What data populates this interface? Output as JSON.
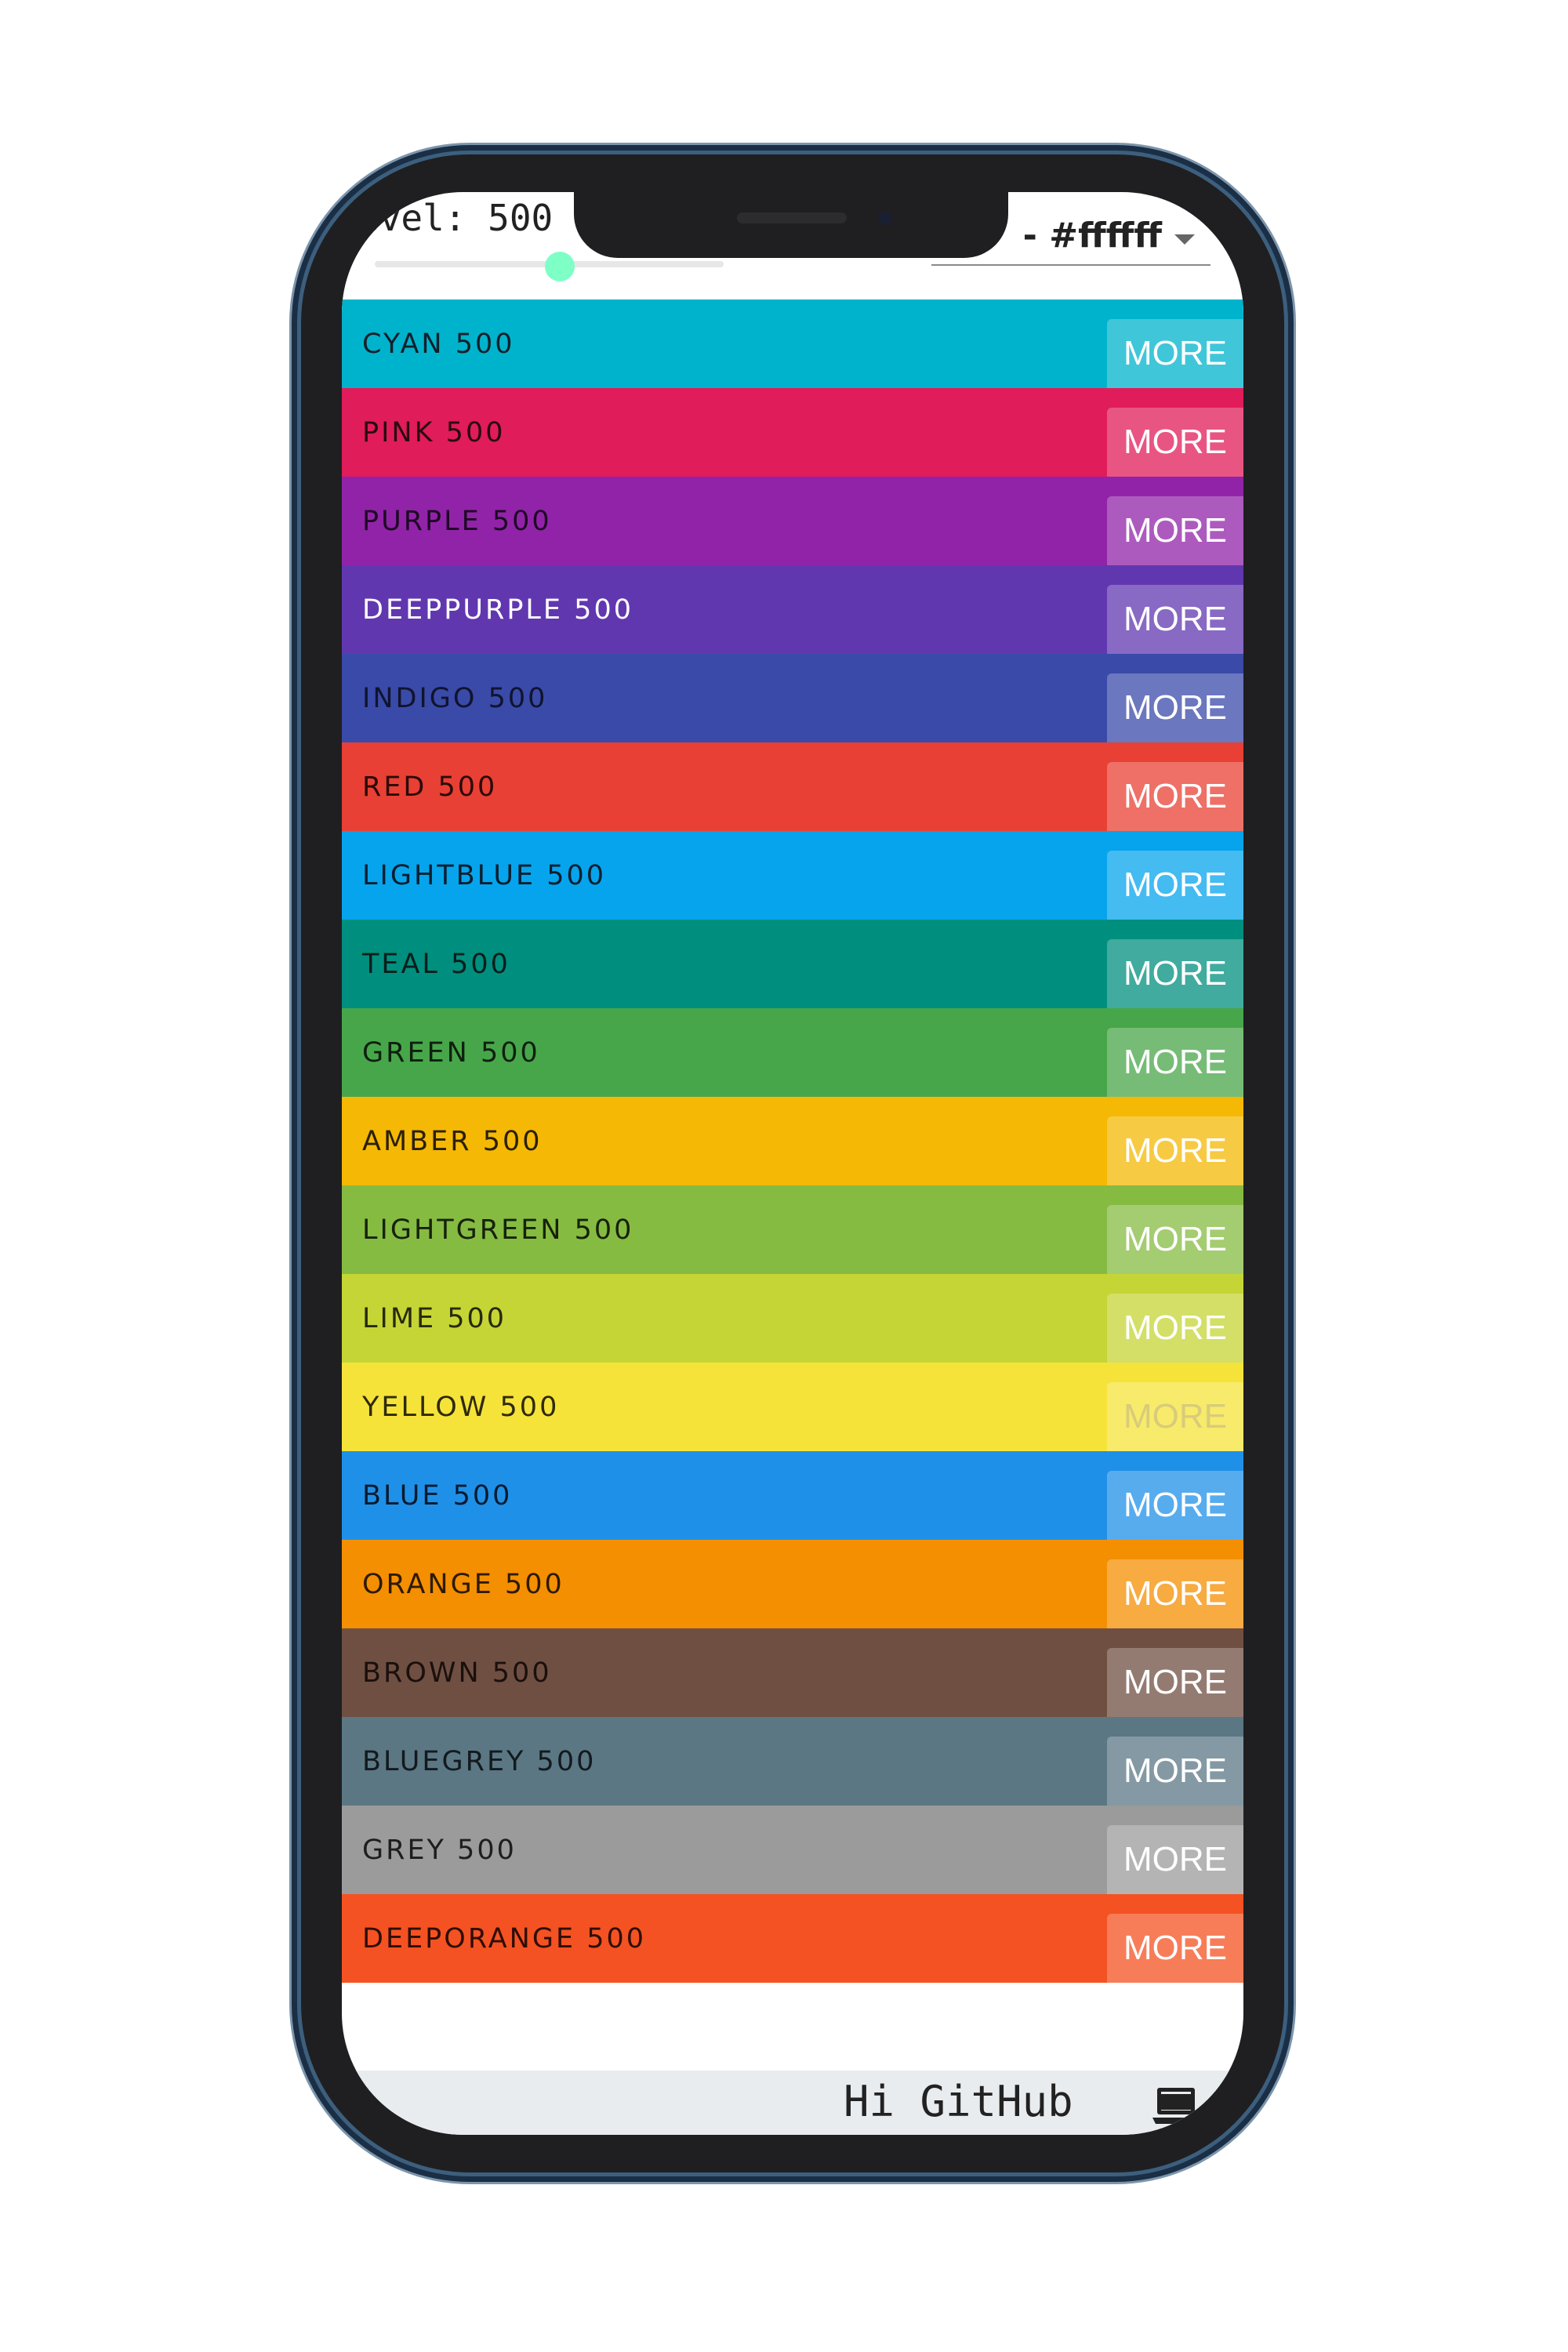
{
  "header": {
    "level_label": "evel: 500",
    "slider_value": 500,
    "slider_min": 50,
    "slider_max": 900,
    "text_color_select_value": "- #ffffff"
  },
  "colors": [
    {
      "name": "CYAN 500",
      "more_label": "MORE",
      "bg": "#00b3cc",
      "text": "#14202b"
    },
    {
      "name": "PINK 500",
      "more_label": "MORE",
      "bg": "#e01c5a",
      "text": "#2a0a14"
    },
    {
      "name": "PURPLE 500",
      "more_label": "MORE",
      "bg": "#9123a9",
      "text": "#1e0a24"
    },
    {
      "name": "DEEPPURPLE 500",
      "more_label": "MORE",
      "bg": "#6137b0",
      "text": "#ffffff"
    },
    {
      "name": "INDIGO 500",
      "more_label": "MORE",
      "bg": "#3a4aa8",
      "text": "#10142e"
    },
    {
      "name": "RED 500",
      "more_label": "MORE",
      "bg": "#e84034",
      "text": "#2a0a08"
    },
    {
      "name": "LIGHTBLUE 500",
      "more_label": "MORE",
      "bg": "#06a4ec",
      "text": "#0a1e2e"
    },
    {
      "name": "TEAL 500",
      "more_label": "MORE",
      "bg": "#008f7e",
      "text": "#0a1e1c"
    },
    {
      "name": "GREEN 500",
      "more_label": "MORE",
      "bg": "#48a64a",
      "text": "#0e200e"
    },
    {
      "name": "AMBER 500",
      "more_label": "MORE",
      "bg": "#f5b804",
      "text": "#2a2004"
    },
    {
      "name": "LIGHTGREEN 500",
      "more_label": "MORE",
      "bg": "#86bb42",
      "text": "#16220a"
    },
    {
      "name": "LIME 500",
      "more_label": "MORE",
      "bg": "#c5d535",
      "text": "#262a0a"
    },
    {
      "name": "YELLOW 500",
      "more_label": "MORE",
      "bg": "#f6e33a",
      "text": "#2e2a0a"
    },
    {
      "name": "BLUE 500",
      "more_label": "MORE",
      "bg": "#1f90e8",
      "text": "#0a1a2e"
    },
    {
      "name": "ORANGE 500",
      "more_label": "MORE",
      "bg": "#f48f02",
      "text": "#2e1a02"
    },
    {
      "name": "BROWN 500",
      "more_label": "MORE",
      "bg": "#704f43",
      "text": "#1a100c"
    },
    {
      "name": "BLUEGREY 500",
      "more_label": "MORE",
      "bg": "#5b7784",
      "text": "#121a1e"
    },
    {
      "name": "GREY 500",
      "more_label": "MORE",
      "bg": "#9b9b9b",
      "text": "#1e1e1e"
    },
    {
      "name": "DEEPORANGE 500",
      "more_label": "MORE",
      "bg": "#f45222",
      "text": "#2e0e06"
    }
  ],
  "footer": {
    "text": "Hi GitHub",
    "icon": "laptop-icon"
  }
}
